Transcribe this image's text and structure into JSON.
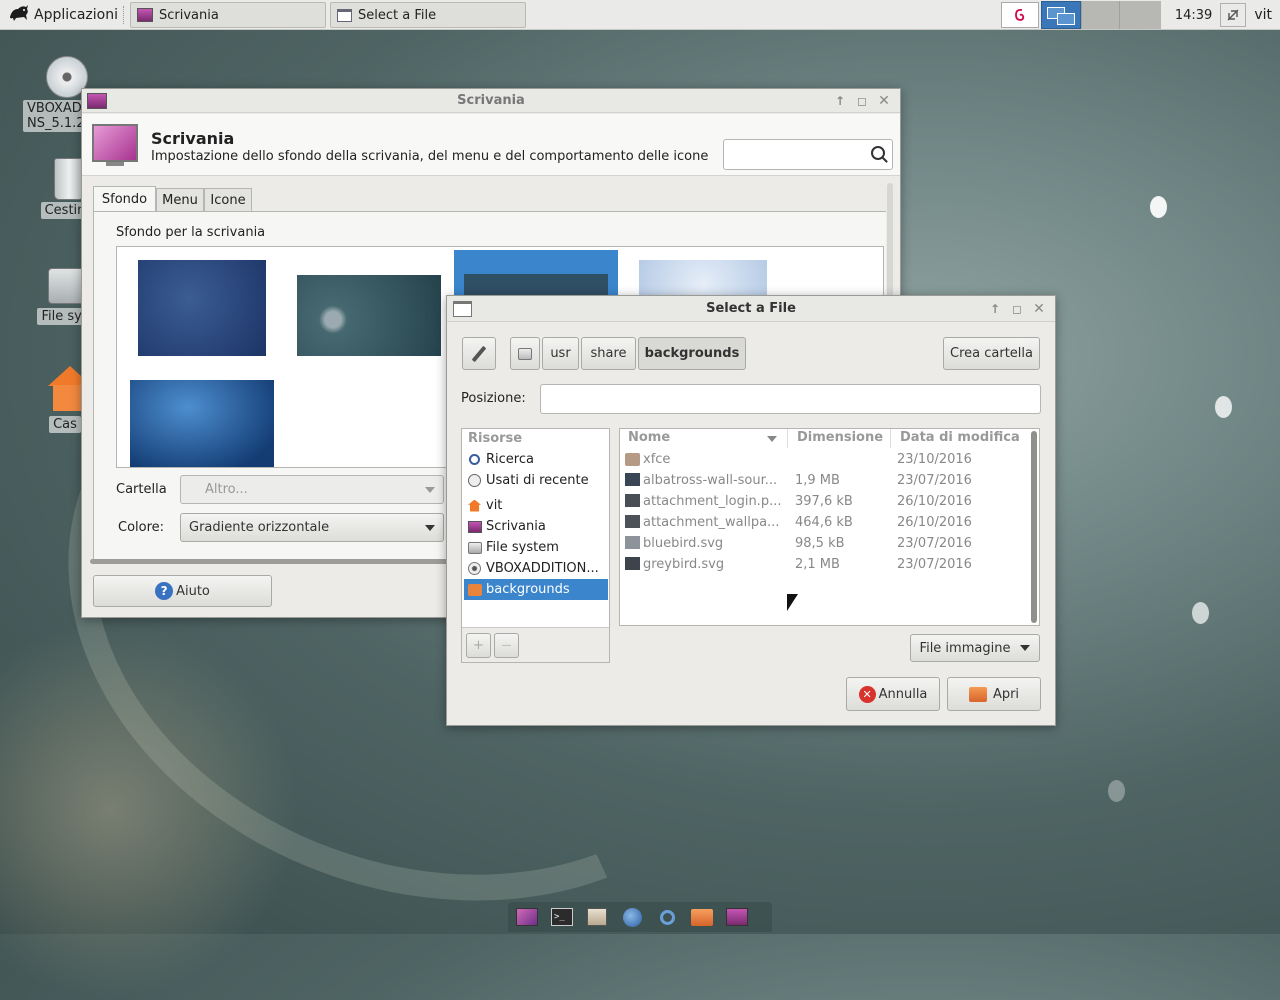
{
  "top_panel": {
    "apps_label": "Applicazioni",
    "tasks": [
      {
        "label": "Scrivania"
      },
      {
        "label": "Select a File"
      }
    ],
    "clock": "14:39",
    "user": "vit"
  },
  "desktop": {
    "icons": [
      {
        "label": "VBOXAD NS_5.1.2",
        "icon": "cdrom-icon"
      },
      {
        "label": "Cestin",
        "icon": "trash-icon"
      },
      {
        "label": "File sys",
        "icon": "harddisk-icon"
      },
      {
        "label": "Cas",
        "icon": "home-icon"
      }
    ]
  },
  "settings_window": {
    "title": "Scrivania",
    "header_title": "Scrivania",
    "header_subtitle": "Impostazione dello sfondo della scrivania, del menu e del comportamento delle icone",
    "tabs": [
      {
        "label": "Sfondo"
      },
      {
        "label": "Menu"
      },
      {
        "label": "Icone"
      }
    ],
    "section_label": "Sfondo per la scrivania",
    "cartella_label": "Cartella",
    "cartella_value": "Altro...",
    "colore_label": "Colore:",
    "colore_value": "Gradiente orizzontale",
    "help_button": "Aiuto"
  },
  "file_dialog": {
    "title": "Select a File",
    "path": [
      "usr",
      "share",
      "backgrounds"
    ],
    "create_folder": "Crea cartella",
    "location_label": "Posizione:",
    "location_value": "",
    "places_header": "Risorse",
    "places": [
      {
        "label": "Ricerca",
        "icon": "search-icon"
      },
      {
        "label": "Usati di recente",
        "icon": "recent-icon"
      },
      {
        "label": "vit",
        "icon": "home-icon"
      },
      {
        "label": "Scrivania",
        "icon": "desktop-icon"
      },
      {
        "label": "File system",
        "icon": "harddisk-icon"
      },
      {
        "label": "VBOXADDITION...",
        "icon": "cdrom-icon"
      },
      {
        "label": "backgrounds",
        "icon": "folder-icon",
        "selected": true
      }
    ],
    "columns": {
      "name": "Nome",
      "size": "Dimensione",
      "modified": "Data di modifica"
    },
    "files": [
      {
        "name": "xfce",
        "size": "",
        "modified": "23/10/2016",
        "type": "folder"
      },
      {
        "name": "albatross-wall-sour...",
        "size": "1,9 MB",
        "modified": "23/07/2016",
        "type": "image"
      },
      {
        "name": "attachment_login.p...",
        "size": "397,6 kB",
        "modified": "26/10/2016",
        "type": "image"
      },
      {
        "name": "attachment_wallpa...",
        "size": "464,6 kB",
        "modified": "26/10/2016",
        "type": "image"
      },
      {
        "name": "bluebird.svg",
        "size": "98,5 kB",
        "modified": "23/07/2016",
        "type": "image"
      },
      {
        "name": "greybird.svg",
        "size": "2,1 MB",
        "modified": "23/07/2016",
        "type": "image"
      }
    ],
    "filter": "File immagine",
    "cancel_button": "Annulla",
    "open_button": "Apri",
    "add_symbol": "+",
    "remove_symbol": "—"
  },
  "colors": {
    "selection": "#3a85cc",
    "cancel_icon": "#d8322d",
    "home_icon": "#f07a2a",
    "folder_icon": "#e8843c",
    "desktop_icon": "#b03a9e"
  }
}
